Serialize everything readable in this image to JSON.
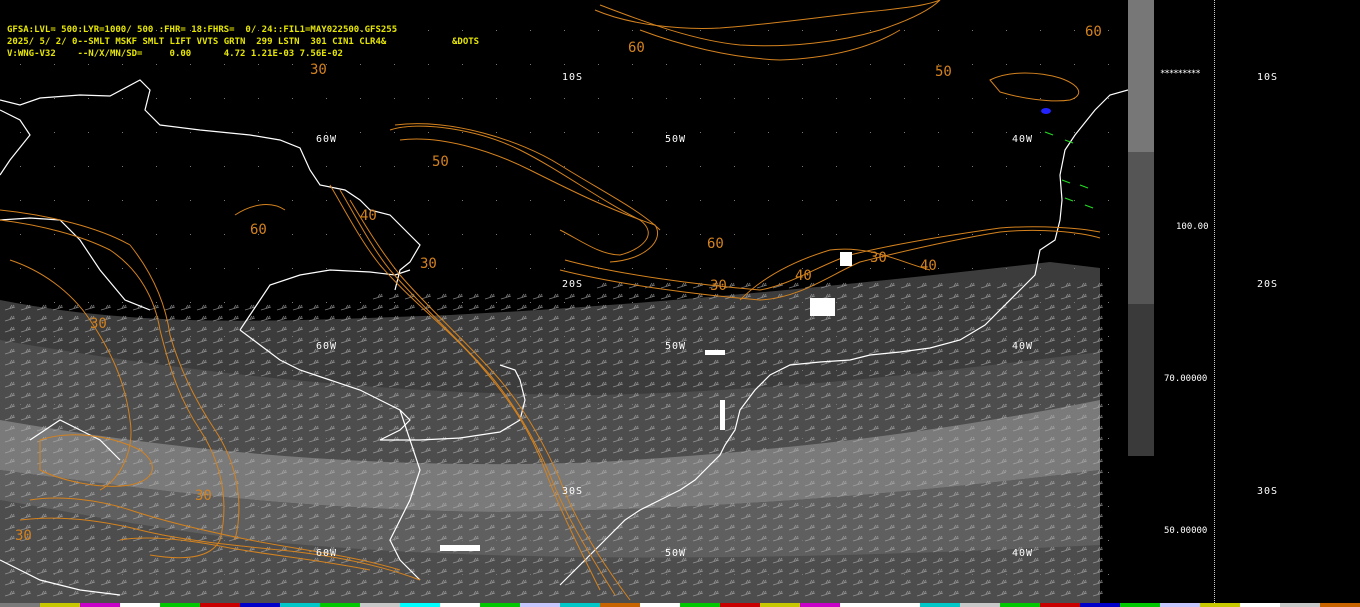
{
  "header": {
    "line1": "GFSA:LVL= 500:LYR=1000/ 500 :FHR= 18:FHRS=  0/ 24::FIL1=MAY022500.GFS255",
    "line2": "2025/ 5/ 2/ 0--SMLT MSKF SMLT LIFT VVTS GRTN  299 LSTN  301 CIN1 CLR4&",
    "line3": "V:WNG-V32    --N/X/MN/SD=     0.00      4.72 1.21E-03 7.56E-02",
    "dots_label": "&DOTS"
  },
  "grid_labels": {
    "lat_10s": "10S",
    "lat_20s": "20S",
    "lat_30s": "30S",
    "lon_60w": "60W",
    "lon_50w": "50W",
    "lon_40w": "40W"
  },
  "contour_labels": [
    "30",
    "40",
    "50",
    "60"
  ],
  "scale": {
    "v100": "100.00",
    "v70": "70.00000",
    "v50": "50.00000",
    "stars": "*********"
  },
  "colors": {
    "background": "#000000",
    "contour": "#d4821e",
    "coast": "#ffffff",
    "header_text": "#e6e600",
    "band_dark": "#3c3c3c",
    "band_mid": "#5a5a5a",
    "band_light": "#8a8a8a"
  },
  "color_strip": [
    "#7a7a7a",
    "#c8c800",
    "#c800c8",
    "#ffffff",
    "#00c800",
    "#c80000",
    "#0000c8",
    "#00c8c8",
    "#00c800",
    "#c8c8c8",
    "#00ffff",
    "#ffffff",
    "#00c800",
    "#c8c8ff",
    "#00c8c8",
    "#c86400",
    "#ffffff",
    "#00c800",
    "#c80000",
    "#c8c800",
    "#c800c8",
    "#ffffff",
    "#ffffff",
    "#00c8c8",
    "#c8c8c8",
    "#00c800",
    "#c80000",
    "#0000c8",
    "#00c800",
    "#c8c8ff",
    "#c8c800",
    "#ffffff",
    "#c8c8c8",
    "#c86400"
  ]
}
